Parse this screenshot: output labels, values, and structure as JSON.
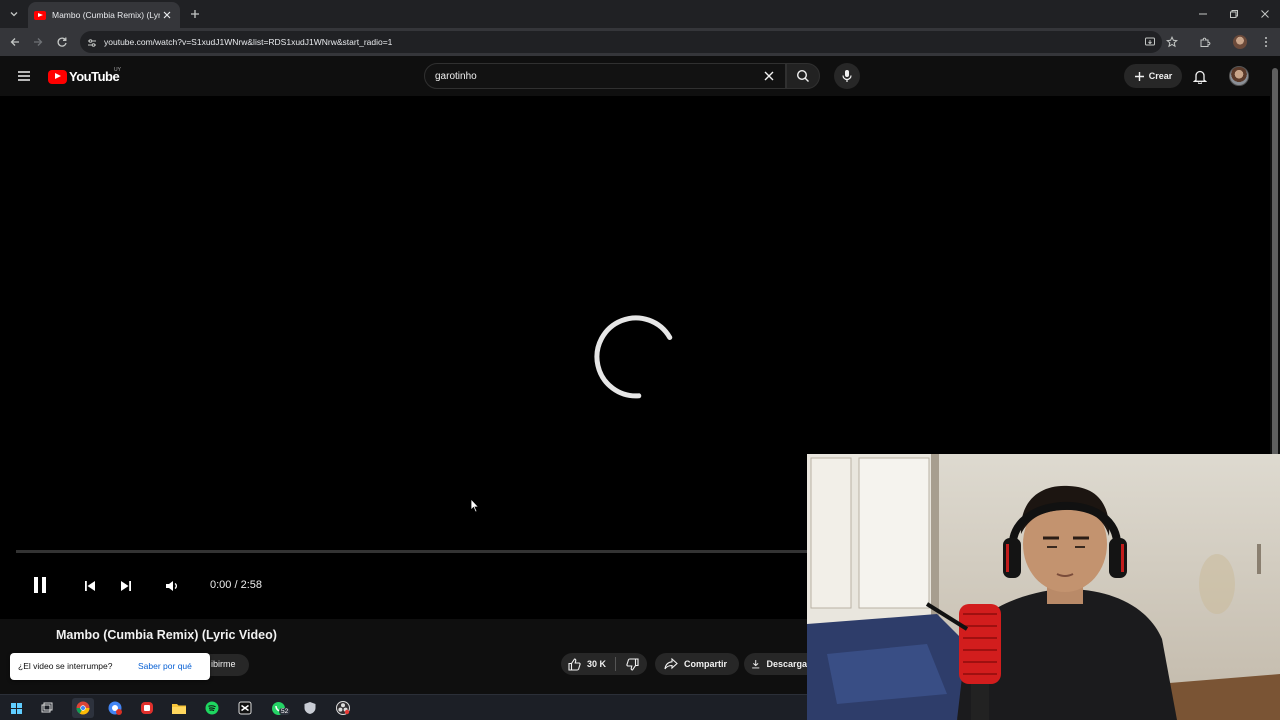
{
  "browser": {
    "tab_title": "Mambo (Cumbia Remix) (Lyric V",
    "url": "youtube.com/watch?v=S1xudJ1WNrw&list=RDS1xudJ1WNrw&start_radio=1"
  },
  "youtube": {
    "logo_text": "YouTube",
    "country_code": "UY",
    "search_query": "garotinho",
    "create_label": "Crear"
  },
  "player": {
    "state": "loading",
    "time": "0:00 / 2:58",
    "progress_fraction": 0
  },
  "video": {
    "title": "Mambo (Cumbia Remix) (Lyric Video)",
    "subscribe_partial": "ibirme",
    "likes": "30 K",
    "share_label": "Compartir",
    "download_label": "Descarga"
  },
  "interruption_popup": {
    "question": "¿El video se interrumpe?",
    "link": "Saber por qué"
  },
  "taskbar": {
    "whatsapp_badge": "52",
    "apps": [
      "start-icon",
      "task-view-icon",
      "chrome-icon",
      "chrome-profile-icon",
      "app-red-icon",
      "file-explorer-icon",
      "spotify-icon",
      "capcut-icon",
      "whatsapp-icon",
      "app-shield-icon",
      "obs-icon"
    ]
  },
  "colors": {
    "yt_red": "#ff0000",
    "background": "#0f0f0f",
    "link_blue": "#065fd4"
  }
}
